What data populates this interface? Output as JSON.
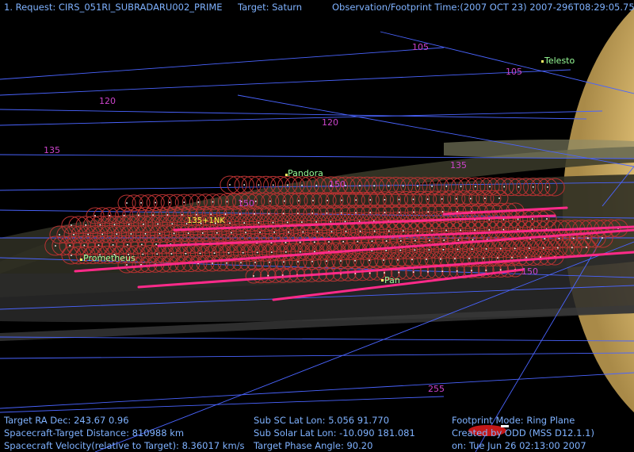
{
  "header": {
    "request": "1. Request: CIRS_051RI_SUBRADARU002_PRIME",
    "target": "Target: Saturn",
    "time": "Observation/Footprint Time:(2007 OCT 23) 2007-296T08:29:05.75"
  },
  "ring_labels": [
    {
      "text": "105"
    },
    {
      "text": "105"
    },
    {
      "text": "120"
    },
    {
      "text": "120"
    },
    {
      "text": "135"
    },
    {
      "text": "135"
    },
    {
      "text": "150"
    },
    {
      "text": "150"
    },
    {
      "text": "150"
    },
    {
      "text": "255"
    }
  ],
  "moons": {
    "telesto": "Telesto",
    "pandora": "Pandora",
    "prometheus": "Prometheus",
    "pan": "Pan"
  },
  "footprint_marker": "135+1NK",
  "footer": {
    "left": [
      "Target RA Dec: 243.67   0.96",
      "Spacecraft-Target Distance:  810988 km",
      "Spacecraft Velocity(relative to Target): 8.36017 km/s"
    ],
    "mid": [
      "Sub SC Lat Lon:  5.056  91.770",
      "Sub Solar Lat Lon: -10.090  181.081",
      "Target Phase Angle: 90.20"
    ],
    "right": [
      "Footprint Mode: Ring Plane",
      "Created by ODD (MSS D12.1.1)",
      "on: Tue Jun 26 02:13:00 2007"
    ]
  },
  "colors": {
    "background": "#000000",
    "header_text": "#7fb2ff",
    "grid_line": "#4a64ff",
    "ring_label": "#cc44cc",
    "moon_label": "#99ff99",
    "footprint": "#b83232",
    "swath": "#ff2a8a",
    "saturn": "#e0c27a"
  }
}
